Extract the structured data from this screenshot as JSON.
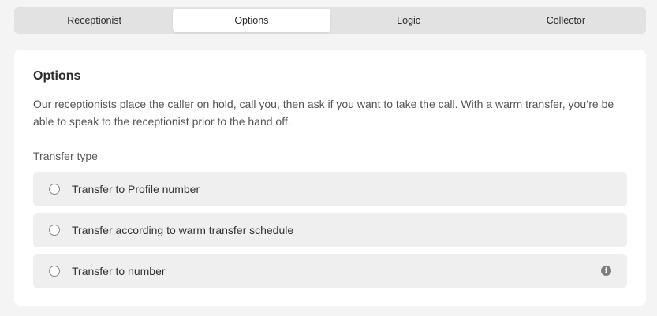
{
  "tabs": [
    {
      "label": "Receptionist",
      "active": false
    },
    {
      "label": "Options",
      "active": true
    },
    {
      "label": "Logic",
      "active": false
    },
    {
      "label": "Collector",
      "active": false
    }
  ],
  "card": {
    "title": "Options",
    "description": "Our receptionists place the caller on hold, call you, then ask if you want to take the call. With a warm transfer, you’re be able to speak to the receptionist prior to the hand off.",
    "transfer_type_label": "Transfer type",
    "options": [
      {
        "label": "Transfer to Profile number",
        "selected": false
      },
      {
        "label": "Transfer according to warm transfer schedule",
        "selected": false
      },
      {
        "label": "Transfer to number",
        "selected": false,
        "icon": "info-icon"
      }
    ],
    "info_glyph": "i"
  },
  "colors": {
    "page_bg": "#f4f4f4",
    "tab_bar_bg": "#e2e2e2",
    "card_bg": "#ffffff",
    "option_bg": "#efefef"
  }
}
